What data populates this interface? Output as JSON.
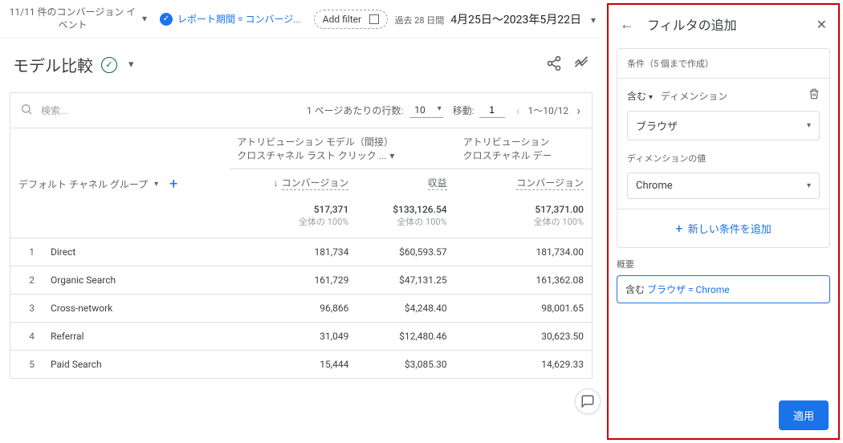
{
  "topbar": {
    "conv_events": "11/11 件のコンバージョン イベント",
    "report_chip": "レポート期間 = コンバージ...",
    "add_filter": "Add filter",
    "date_label": "過去 28 日間",
    "date_range": "4月25日～2023年5月22日"
  },
  "title": "モデル比較",
  "table": {
    "search_placeholder": "検索...",
    "rpp_label": "1 ページあたりの行数:",
    "rpp_value": "10",
    "goto_label": "移動:",
    "goto_value": "1",
    "pager_text": "1～10/12",
    "group1_top": "アトリビューション モデル（間接）",
    "group1_sub": "クロスチャネル ラスト クリック ...",
    "group2_top": "アトリビューション",
    "group2_sub": "クロスチャネル デー",
    "dim_label": "デフォルト チャネル グループ",
    "metric_conv": "コンバージョン",
    "metric_rev": "収益",
    "totals": {
      "conv1": "517,371",
      "conv1_sub": "全体の 100%",
      "rev": "$133,126.54",
      "rev_sub": "全体の 100%",
      "conv2": "517,371.00",
      "conv2_sub": "全体の 100%"
    },
    "rows": [
      {
        "idx": "1",
        "name": "Direct",
        "conv1": "181,734",
        "rev": "$60,593.57",
        "conv2": "181,734.00"
      },
      {
        "idx": "2",
        "name": "Organic Search",
        "conv1": "161,729",
        "rev": "$47,131.25",
        "conv2": "161,362.08"
      },
      {
        "idx": "3",
        "name": "Cross-network",
        "conv1": "96,866",
        "rev": "$4,248.40",
        "conv2": "98,001.65"
      },
      {
        "idx": "4",
        "name": "Referral",
        "conv1": "31,049",
        "rev": "$12,480.46",
        "conv2": "30,623.50"
      },
      {
        "idx": "5",
        "name": "Paid Search",
        "conv1": "15,444",
        "rev": "$3,085.30",
        "conv2": "14,629.33"
      }
    ]
  },
  "panel": {
    "title": "フィルタの追加",
    "cond_header": "条件（5 個まで作成）",
    "include": "含む",
    "dimension": "ディメンション",
    "dim_value": "ブラウザ",
    "dimval_label": "ディメンションの値",
    "dimval_value": "Chrome",
    "add_cond": "新しい条件を追加",
    "summary_label": "概要",
    "sum_include": "含む",
    "sum_text": "ブラウザ = Chrome",
    "apply": "適用"
  }
}
